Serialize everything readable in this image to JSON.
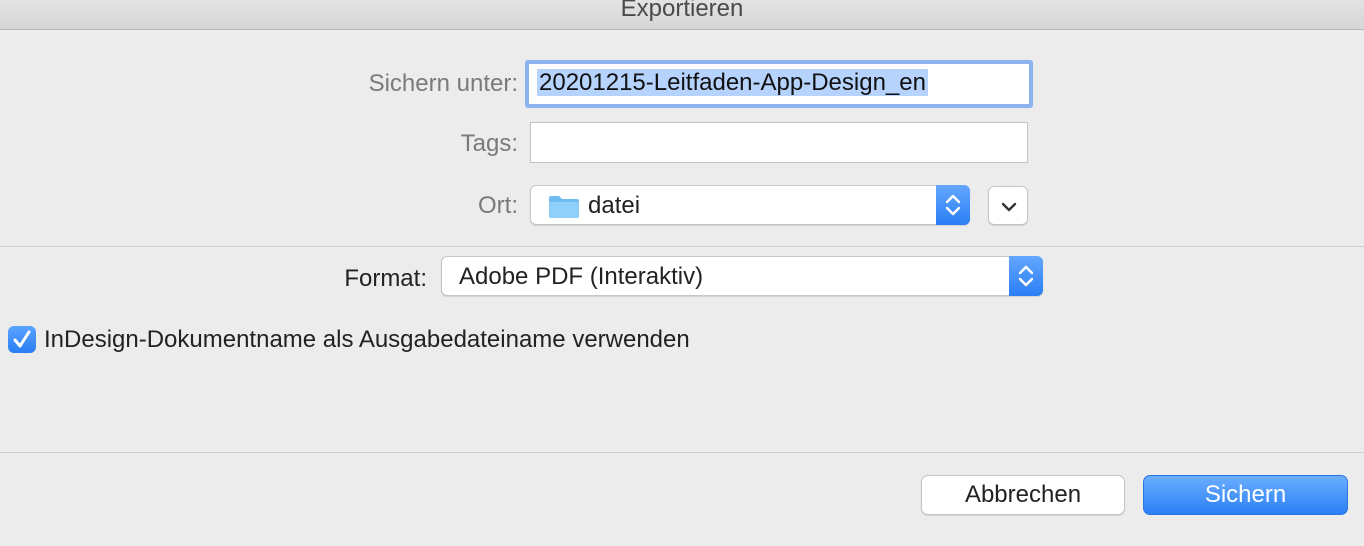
{
  "window": {
    "title": "Exportieren"
  },
  "save_as": {
    "label": "Sichern unter:",
    "value": "20201215-Leitfaden-App-Design_en"
  },
  "tags": {
    "label": "Tags:",
    "value": ""
  },
  "location": {
    "label": "Ort:",
    "value": "datei",
    "icon": "folder-icon"
  },
  "format": {
    "label": "Format:",
    "value": "Adobe PDF (Interaktiv)"
  },
  "options": {
    "use_doc_name_label": "InDesign-Dokumentname als Ausgabedateiname verwenden",
    "use_doc_name_checked": true
  },
  "buttons": {
    "cancel": "Abbrechen",
    "save": "Sichern"
  },
  "colors": {
    "accent": "#2b80f5",
    "selection": "#b5d3fd",
    "background": "#ececec"
  }
}
